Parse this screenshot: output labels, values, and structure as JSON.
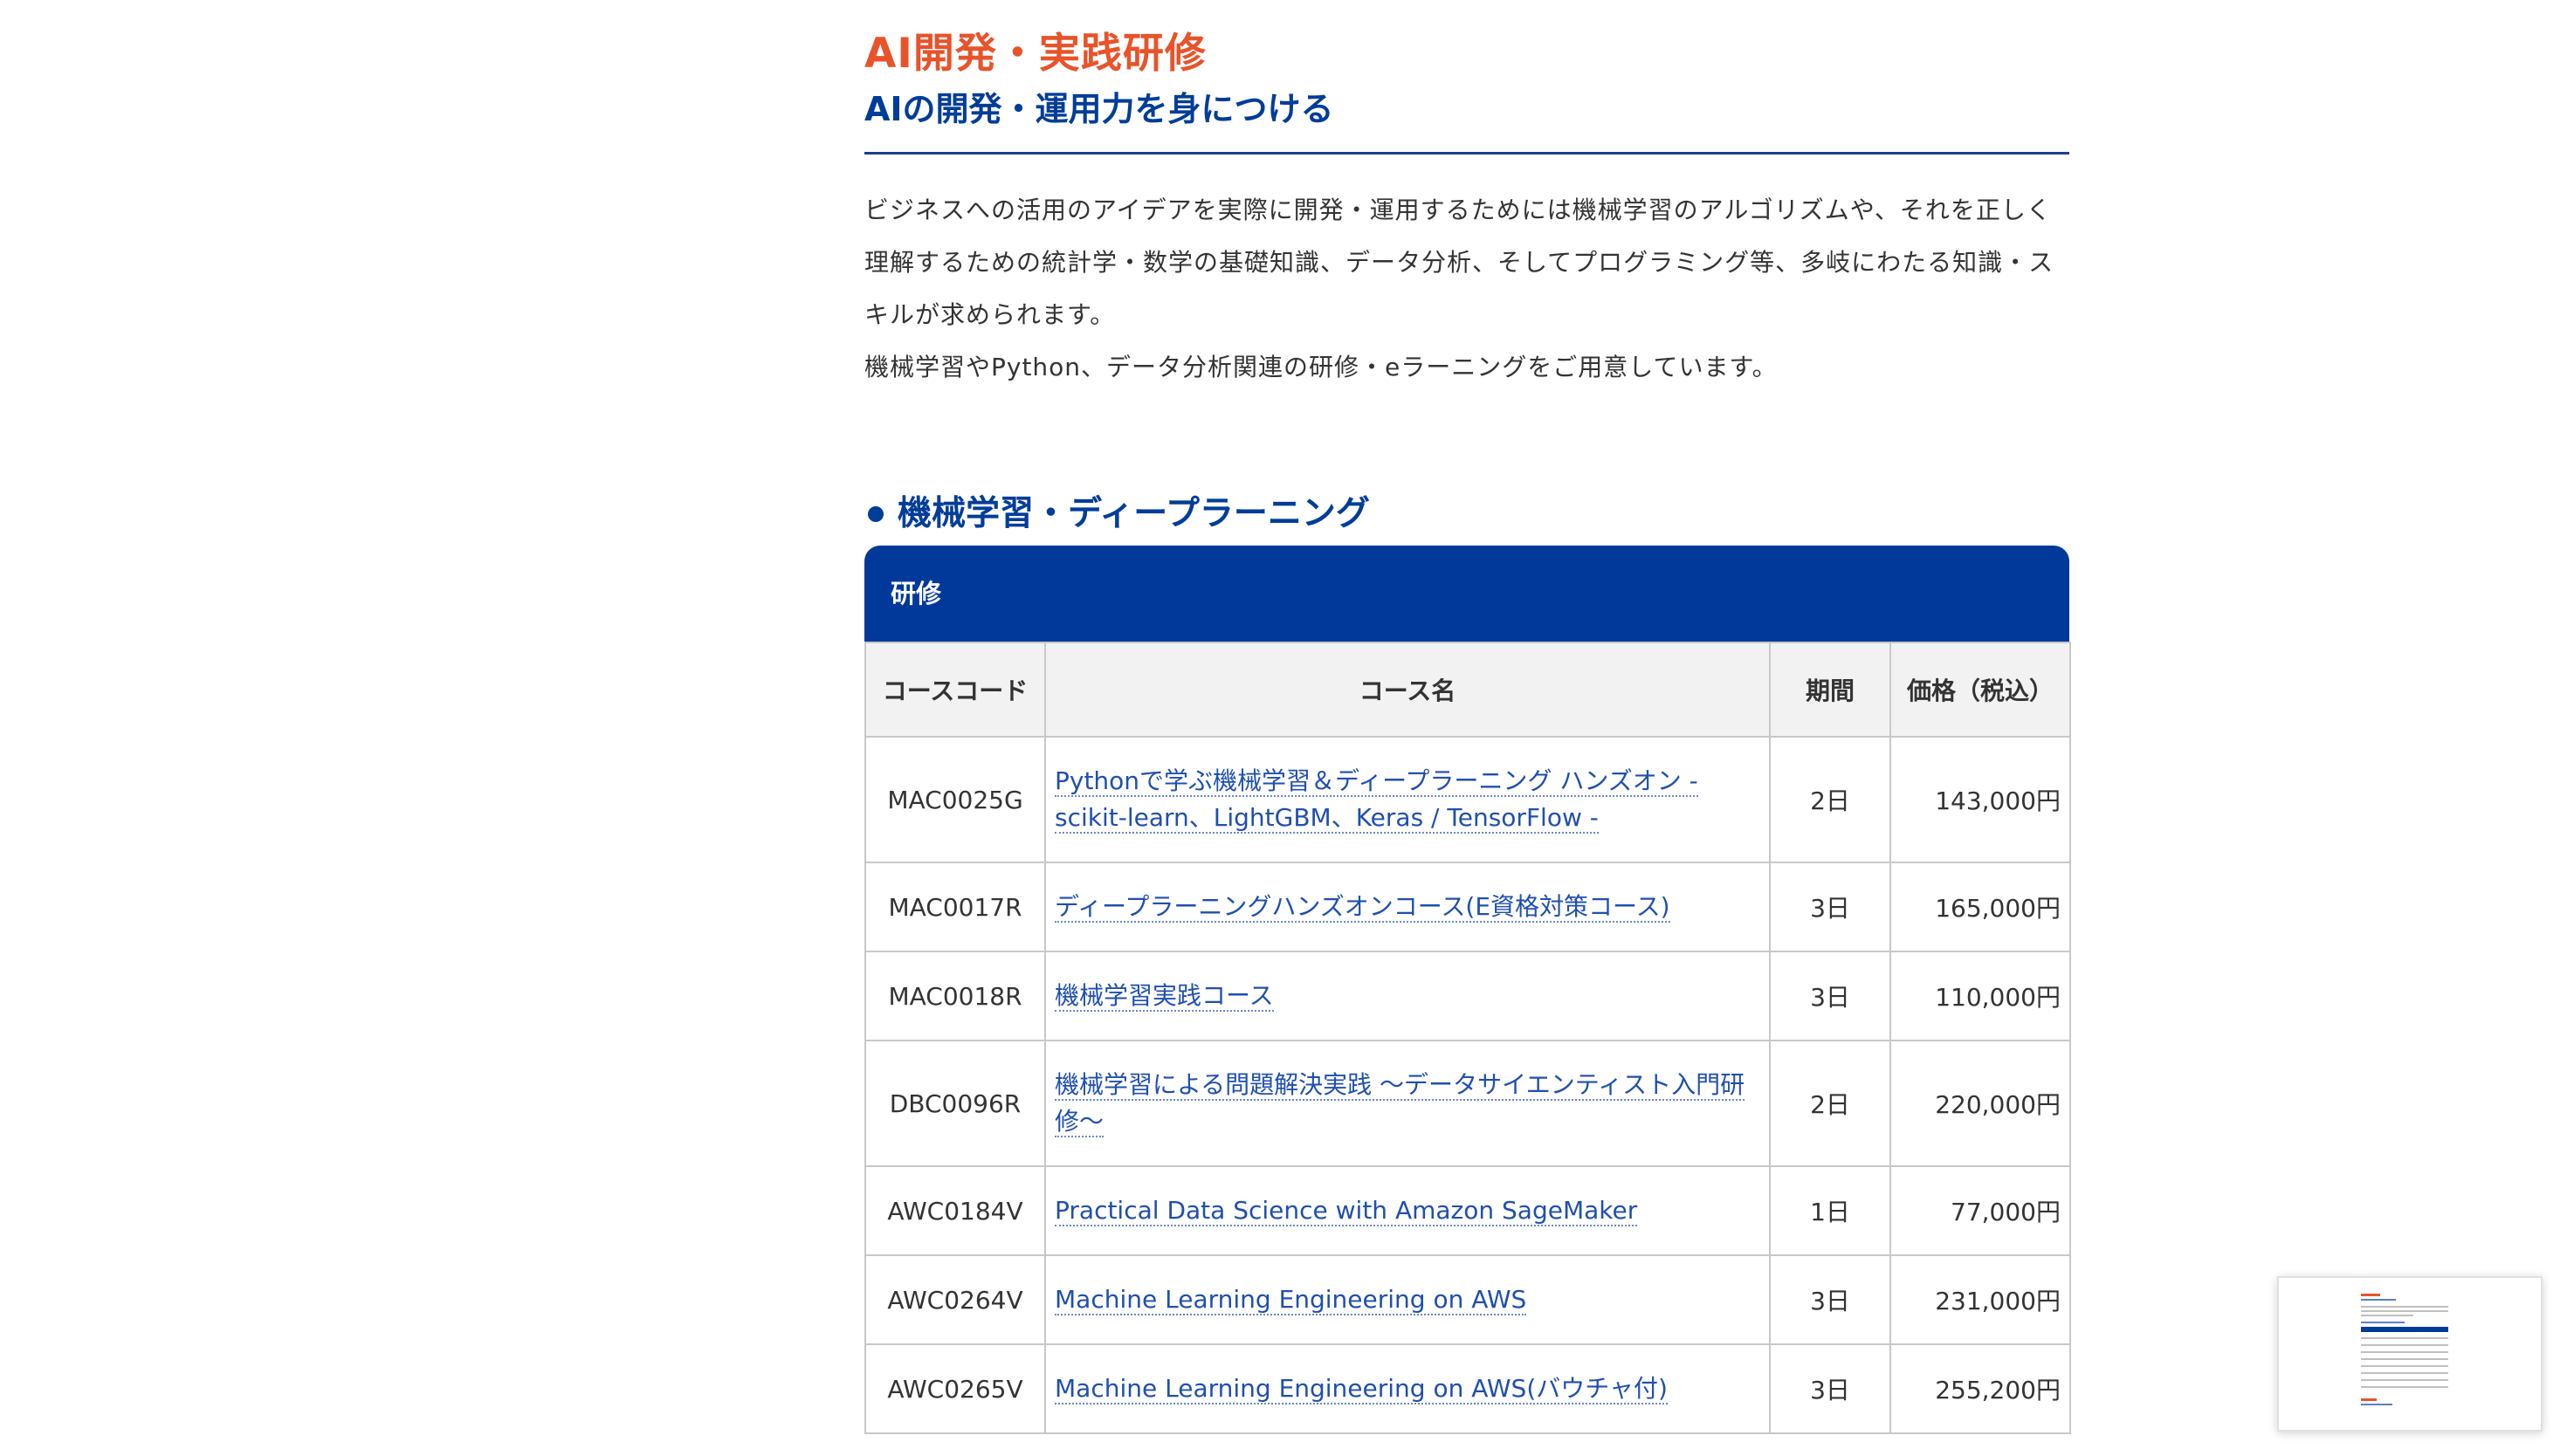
{
  "page": {
    "title": "AI開発・実践研修",
    "subtitle": "AIの開発・運用力を身につける",
    "intro_lines": [
      "ビジネスへの活用のアイデアを実際に開発・運用するためには機械学習のアルゴリズムや、それを正しく",
      "理解するための統計学・数学の基礎知識、データ分析、そしてプログラミング等、多岐にわたる知識・ス",
      "キルが求められます。",
      "機械学習やPython、データ分析関連の研修・eラーニングをご用意しています。"
    ]
  },
  "section": {
    "heading": "機械学習・ディープラーニング",
    "table_banner": "研修",
    "columns": {
      "code": "コースコード",
      "name": "コース名",
      "period": "期間",
      "price": "価格（税込）"
    },
    "rows": [
      {
        "code": "MAC0025G",
        "name": "Pythonで学ぶ機械学習＆ディープラーニング ハンズオン - scikit-learn、LightGBM、Keras / TensorFlow -",
        "period": "2日",
        "price": "143,000円"
      },
      {
        "code": "MAC0017R",
        "name": "ディープラーニングハンズオンコース(E資格対策コース)",
        "period": "3日",
        "price": "165,000円"
      },
      {
        "code": "MAC0018R",
        "name": "機械学習実践コース",
        "period": "3日",
        "price": "110,000円"
      },
      {
        "code": "DBC0096R",
        "name": "機械学習による問題解決実践 ～データサイエンティスト入門研修～",
        "period": "2日",
        "price": "220,000円"
      },
      {
        "code": "AWC0184V",
        "name": "Practical Data Science with Amazon SageMaker",
        "period": "1日",
        "price": "77,000円"
      },
      {
        "code": "AWC0264V",
        "name": "Machine Learning Engineering on AWS",
        "period": "3日",
        "price": "231,000円"
      },
      {
        "code": "AWC0265V",
        "name": "Machine Learning Engineering on AWS(バウチャ付)",
        "period": "3日",
        "price": "255,200円"
      }
    ]
  },
  "colors": {
    "title_orange": "#e8532a",
    "heading_blue": "#003d99",
    "banner_blue": "#00399a",
    "link_blue": "#1f4fb0"
  }
}
